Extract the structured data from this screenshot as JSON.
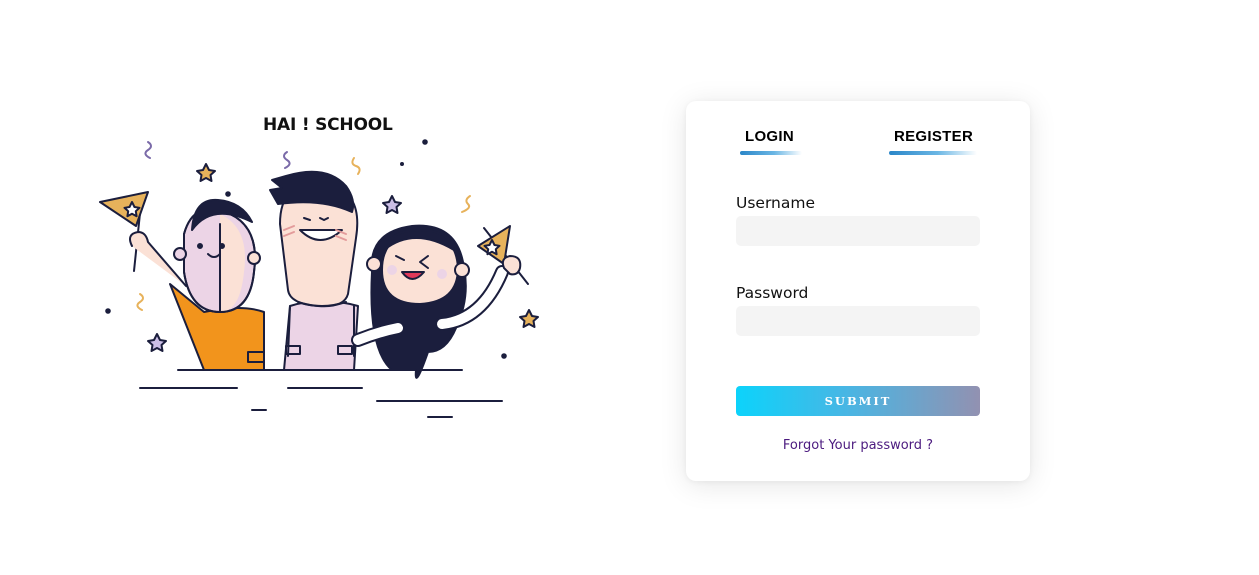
{
  "brand": {
    "title": "HAI ! SCHOOL"
  },
  "auth_card": {
    "tabs": [
      {
        "label": "LOGIN",
        "active": true
      },
      {
        "label": "REGISTER",
        "active": false
      }
    ],
    "fields": {
      "username": {
        "label": "Username",
        "value": "",
        "placeholder": ""
      },
      "password": {
        "label": "Password",
        "value": "",
        "placeholder": ""
      }
    },
    "submit_label": "SUBMIT",
    "forgot_label": "Forgot Your password ?"
  },
  "colors": {
    "tab_underline_start": "#2a86c8",
    "submit_gradient_start": "#0cd3fb",
    "submit_gradient_end": "#9291b1",
    "forgot_link": "#4b1a7f",
    "input_bg": "#f4f4f4"
  },
  "icons": {
    "illustration": "three-kids-celebrating-with-flags-illustration"
  }
}
